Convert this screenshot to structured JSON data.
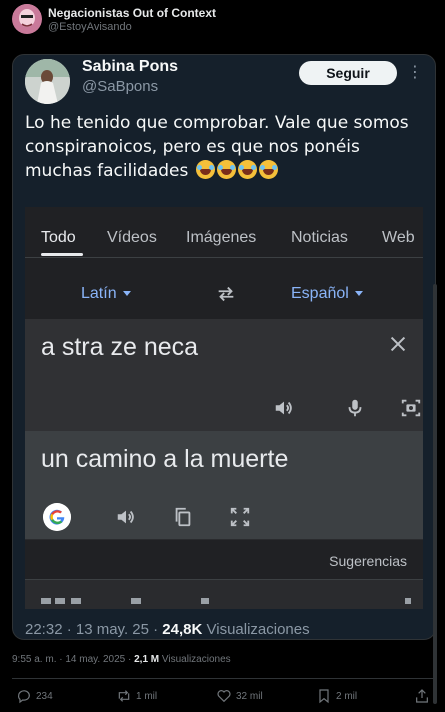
{
  "outer_post": {
    "display_name": "Negacionistas Out of Context",
    "handle": "@EstoyAvisando",
    "meta": {
      "time_date": "9:55 a. m. · 14 may. 2025 ·",
      "views_count": "2,1 M",
      "views_label": "Visualizaciones"
    },
    "actions": [
      {
        "icon": "reply-icon",
        "count": "234"
      },
      {
        "icon": "repost-icon",
        "count": "1 mil"
      },
      {
        "icon": "like-icon",
        "count": "32 mil"
      },
      {
        "icon": "bookmark-icon",
        "count": "2 mil"
      },
      {
        "icon": "share-icon",
        "count": ""
      }
    ]
  },
  "quoted_post": {
    "display_name": "Sabina Pons",
    "handle": "@SaBpons",
    "follow_label": "Seguir",
    "text": "Lo he tenido que comprobar. Vale que somos conspiranoicos, pero es que nos ponéis muchas facilidades",
    "emoji_count": 4,
    "meta": {
      "time_date": "22:32 · 13 may. 25 ·",
      "views_count": "24,8K",
      "views_label": "Visualizaciones"
    }
  },
  "translate_screenshot": {
    "tabs": [
      "Todo",
      "Vídeos",
      "Imágenes",
      "Noticias",
      "Web"
    ],
    "active_tab": "Todo",
    "source_language": "Latín",
    "target_language": "Español",
    "source_text": "a stra ze neca",
    "translated_text": "un camino a la muerte",
    "suggestions_label": "Sugerencias"
  },
  "colors": {
    "link_blue": "#8ab4f8",
    "card_bg": "#15202b",
    "panel_dark": "#202124",
    "panel_mid": "#303134",
    "panel_result": "#3c4043"
  }
}
